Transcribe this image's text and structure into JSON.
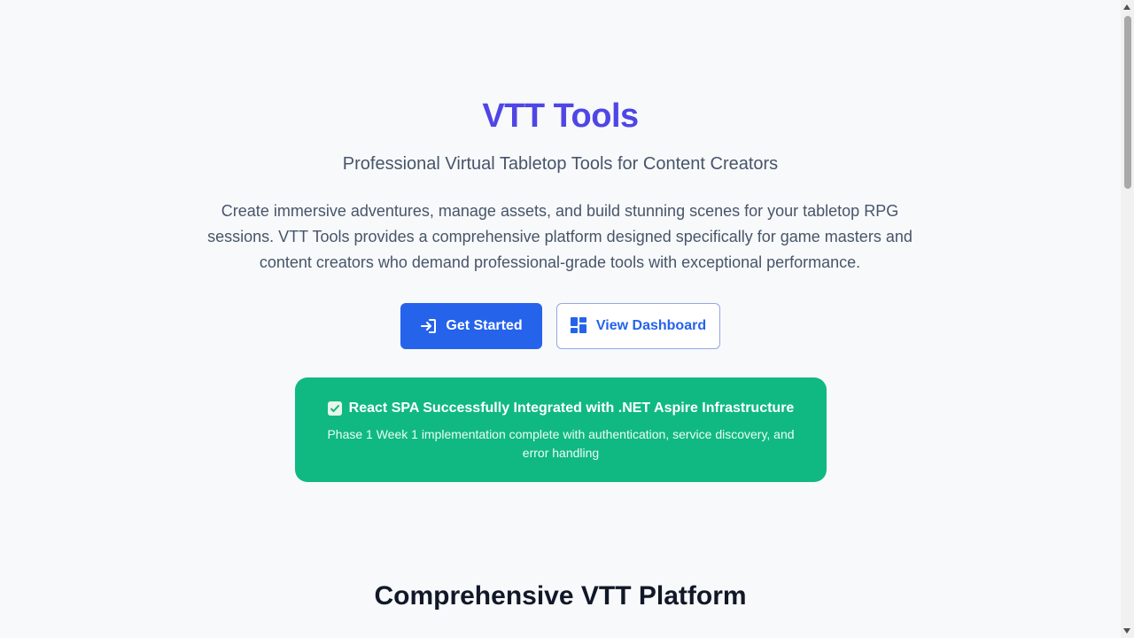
{
  "hero": {
    "title": "VTT Tools",
    "subtitle": "Professional Virtual Tabletop Tools for Content Creators",
    "description": "Create immersive adventures, manage assets, and build stunning scenes for your tabletop RPG sessions. VTT Tools provides a comprehensive platform designed specifically for game masters and content creators who demand professional-grade tools with exceptional performance."
  },
  "actions": {
    "get_started": {
      "label": "Get Started",
      "icon": "login-icon"
    },
    "view_dashboard": {
      "label": "View Dashboard",
      "icon": "dashboard-icon"
    }
  },
  "status_banner": {
    "icon": "check-icon",
    "title": "React SPA Successfully Integrated with .NET Aspire Infrastructure",
    "text": "Phase 1 Week 1 implementation complete with authentication, service discovery, and error handling"
  },
  "section": {
    "title": "Comprehensive VTT Platform"
  },
  "colors": {
    "brand": "#4f46e5",
    "primary": "#2563eb",
    "success": "#10b981",
    "background": "#f8f9fb"
  }
}
